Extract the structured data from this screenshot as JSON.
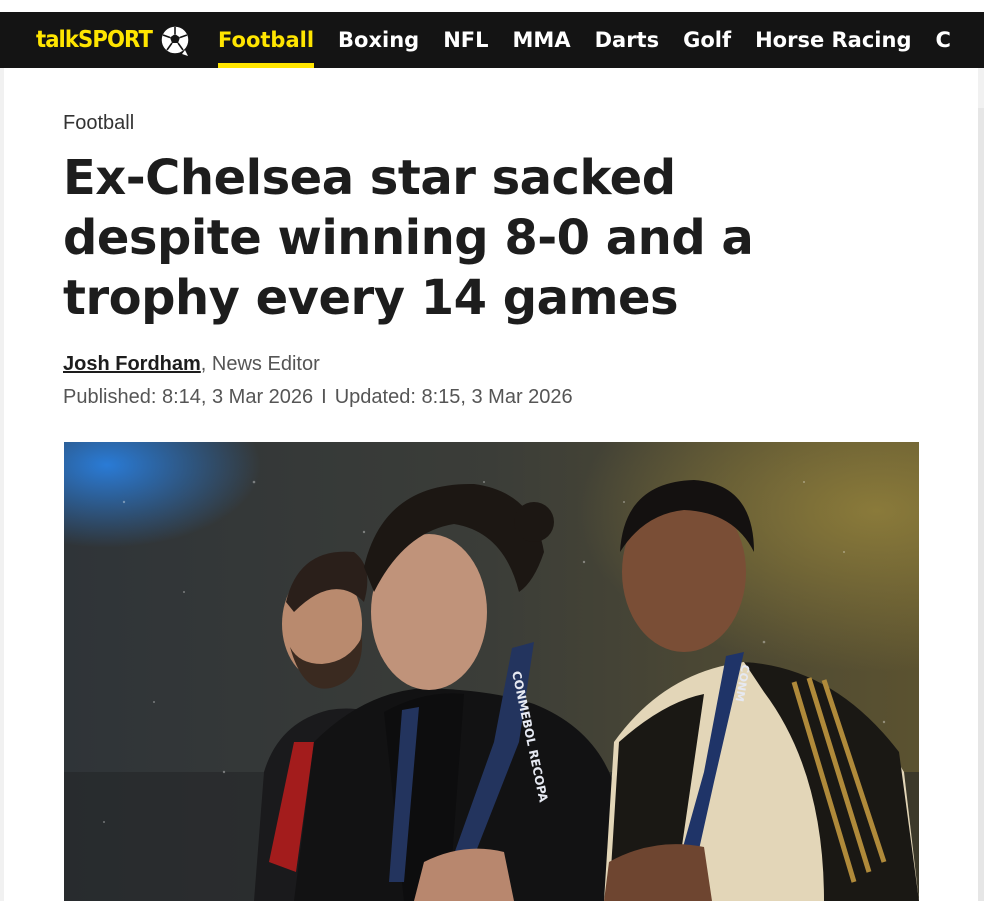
{
  "brand": {
    "logo_text": "talkSPORT",
    "accent_color": "#ffe500",
    "nav_bg": "#141414"
  },
  "nav": {
    "items": [
      {
        "label": "Football",
        "active": true
      },
      {
        "label": "Boxing"
      },
      {
        "label": "NFL"
      },
      {
        "label": "MMA"
      },
      {
        "label": "Darts"
      },
      {
        "label": "Golf"
      },
      {
        "label": "Horse Racing"
      },
      {
        "label": "C"
      }
    ]
  },
  "article": {
    "category": "Football",
    "headline": "Ex-Chelsea star sacked despite winning 8-0 and a trophy every 14 games",
    "author": "Josh Fordham",
    "author_suffix": ", News Editor",
    "published": "Published: 8:14, 3 Mar 2026",
    "separator": "I",
    "updated": "Updated: 8:15, 3 Mar 2026",
    "hero_image": {
      "lanyard_text_1": "CONMEBOL RECOPA",
      "lanyard_text_2": "CONM"
    }
  }
}
